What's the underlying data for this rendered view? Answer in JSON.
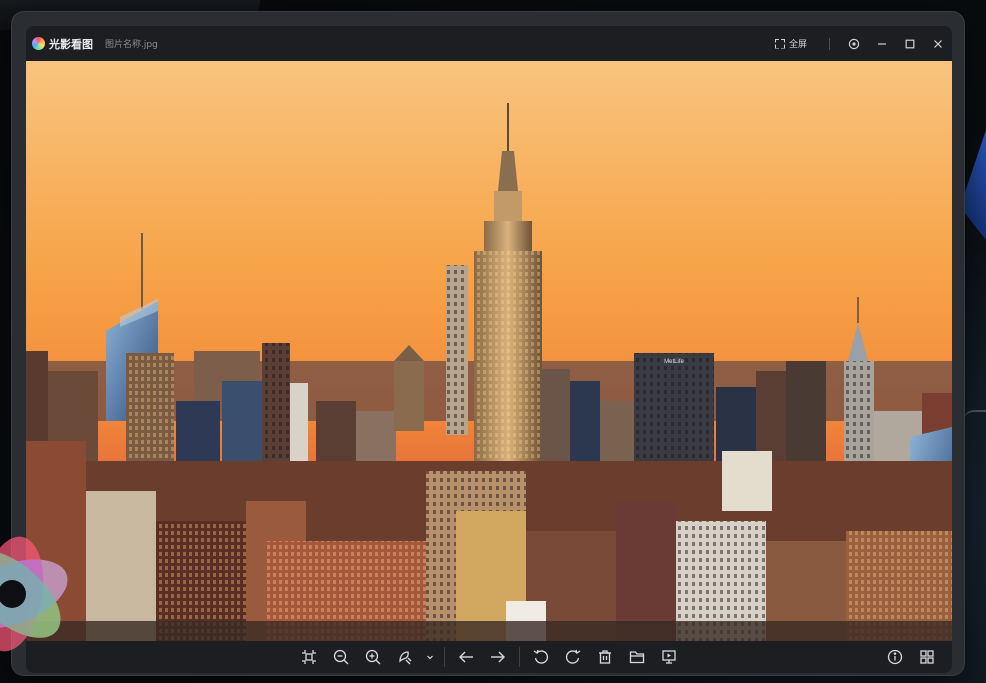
{
  "window": {
    "app_name": "光影看图",
    "file_name": "图片名称.jpg",
    "fullscreen_label": "全屏"
  },
  "image": {
    "billboard_text": "MetLife"
  },
  "colors": {
    "window_bg": "#2a2d31",
    "bar_bg": "#1c1e21",
    "icon": "#d7dbe0",
    "sky_top": "#f7b26a",
    "sky_bottom": "#f07a3a"
  },
  "toolbar": {
    "icons": [
      "fit-icon",
      "zoom-out-icon",
      "zoom-in-icon",
      "edit-icon",
      "dropdown-icon",
      "prev-icon",
      "next-icon",
      "rotate-left-icon",
      "rotate-right-icon",
      "delete-icon",
      "folder-icon",
      "slideshow-icon",
      "info-icon",
      "grid-icon"
    ]
  }
}
